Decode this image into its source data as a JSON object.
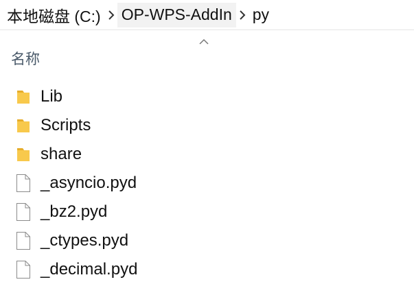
{
  "breadcrumb": {
    "segments": [
      "本地磁盘 (C:)",
      "OP-WPS-AddIn",
      "py"
    ]
  },
  "columns": {
    "name": "名称"
  },
  "files": [
    {
      "name": "Lib",
      "type": "folder"
    },
    {
      "name": "Scripts",
      "type": "folder"
    },
    {
      "name": "share",
      "type": "folder"
    },
    {
      "name": "_asyncio.pyd",
      "type": "file"
    },
    {
      "name": "_bz2.pyd",
      "type": "file"
    },
    {
      "name": "_ctypes.pyd",
      "type": "file"
    },
    {
      "name": "_decimal.pyd",
      "type": "file"
    }
  ],
  "colors": {
    "folder": "#f8c94c",
    "folder_dark": "#e6ad2a",
    "file_border": "#8a8a8a"
  }
}
